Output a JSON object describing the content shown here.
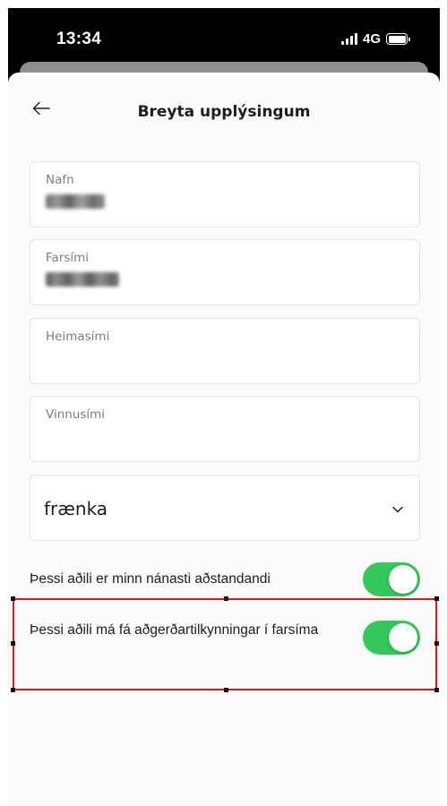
{
  "status_bar": {
    "time": "13:34",
    "network": "4G"
  },
  "header": {
    "title": "Breyta upplýsingum",
    "back_icon": "arrow-left-icon"
  },
  "form": {
    "fields": [
      {
        "label": "Nafn",
        "value_redacted": true
      },
      {
        "label": "Farsími",
        "value_redacted": true
      },
      {
        "label": "Heimasími",
        "value": ""
      },
      {
        "label": "Vinnusími",
        "value": ""
      }
    ],
    "relation_select": {
      "value": "frænka",
      "icon": "chevron-down-icon"
    }
  },
  "toggles": [
    {
      "label": "Þessi aðili er minn nánasti aðstandandi",
      "on": true
    },
    {
      "label": "Þessi aðili má fá aðgerðartilkynningar í farsíma",
      "on": true
    }
  ],
  "colors": {
    "toggle_on": "#34c759",
    "highlight": "#e0151b"
  }
}
